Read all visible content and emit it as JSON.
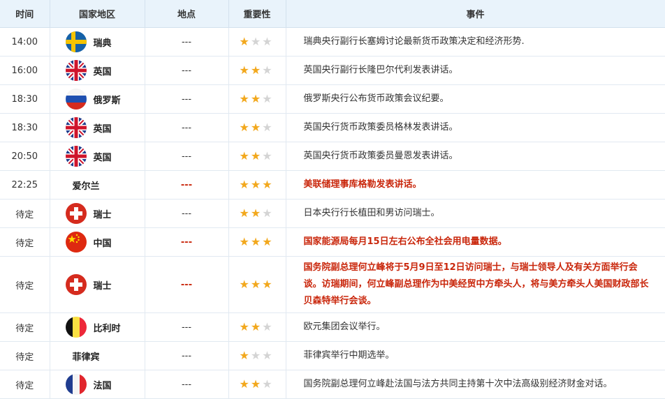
{
  "headers": {
    "time": "时间",
    "country": "国家地区",
    "place": "地点",
    "importance": "重要性",
    "event": "事件"
  },
  "colors": {
    "header_bg": "#e9f3fb",
    "highlight": "#c9260b",
    "star_on": "#f2a81d",
    "star_off": "#d4d4d4"
  },
  "rows": [
    {
      "time": "14:00",
      "country": "瑞典",
      "flag": "sweden",
      "place": "---",
      "stars": 1,
      "event": "瑞典央行副行长塞姆讨论最新货币政策决定和经济形势.",
      "highlight": false
    },
    {
      "time": "16:00",
      "country": "英国",
      "flag": "uk",
      "place": "---",
      "stars": 2,
      "event": "英国央行副行长隆巴尔代利发表讲话。",
      "highlight": false
    },
    {
      "time": "18:30",
      "country": "俄罗斯",
      "flag": "russia",
      "place": "---",
      "stars": 2,
      "event": "俄罗斯央行公布货币政策会议纪要。",
      "highlight": false
    },
    {
      "time": "18:30",
      "country": "英国",
      "flag": "uk",
      "place": "---",
      "stars": 2,
      "event": "英国央行货币政策委员格林发表讲话。",
      "highlight": false
    },
    {
      "time": "20:50",
      "country": "英国",
      "flag": "uk",
      "place": "---",
      "stars": 2,
      "event": "英国央行货币政策委员曼恩发表讲话。",
      "highlight": false
    },
    {
      "time": "22:25",
      "country": "爱尔兰",
      "flag": "",
      "place": "---",
      "stars": 3,
      "event": "美联储理事库格勒发表讲话。",
      "highlight": true
    },
    {
      "time": "待定",
      "country": "瑞士",
      "flag": "switzerland",
      "place": "---",
      "stars": 2,
      "event": "日本央行行长植田和男访问瑞士。",
      "highlight": false
    },
    {
      "time": "待定",
      "country": "中国",
      "flag": "china",
      "place": "---",
      "stars": 3,
      "event": "国家能源局每月15日左右公布全社会用电量数据。",
      "highlight": true
    },
    {
      "time": "待定",
      "country": "瑞士",
      "flag": "switzerland",
      "place": "---",
      "stars": 3,
      "event": "国务院副总理何立峰将于5月9日至12日访问瑞士，与瑞士领导人及有关方面举行会谈。访瑞期间，何立峰副总理作为中美经贸中方牵头人，将与美方牵头人美国财政部长贝森特举行会谈。",
      "highlight": true,
      "tall": true
    },
    {
      "time": "待定",
      "country": "比利时",
      "flag": "belgium",
      "place": "---",
      "stars": 2,
      "event": "欧元集团会议举行。",
      "highlight": false
    },
    {
      "time": "待定",
      "country": "菲律宾",
      "flag": "",
      "place": "---",
      "stars": 1,
      "event": "菲律宾举行中期选举。",
      "highlight": false
    },
    {
      "time": "待定",
      "country": "法国",
      "flag": "france",
      "place": "---",
      "stars": 2,
      "event": "国务院副总理何立峰赴法国与法方共同主持第十次中法高级别经济财金对话。",
      "highlight": false
    }
  ]
}
